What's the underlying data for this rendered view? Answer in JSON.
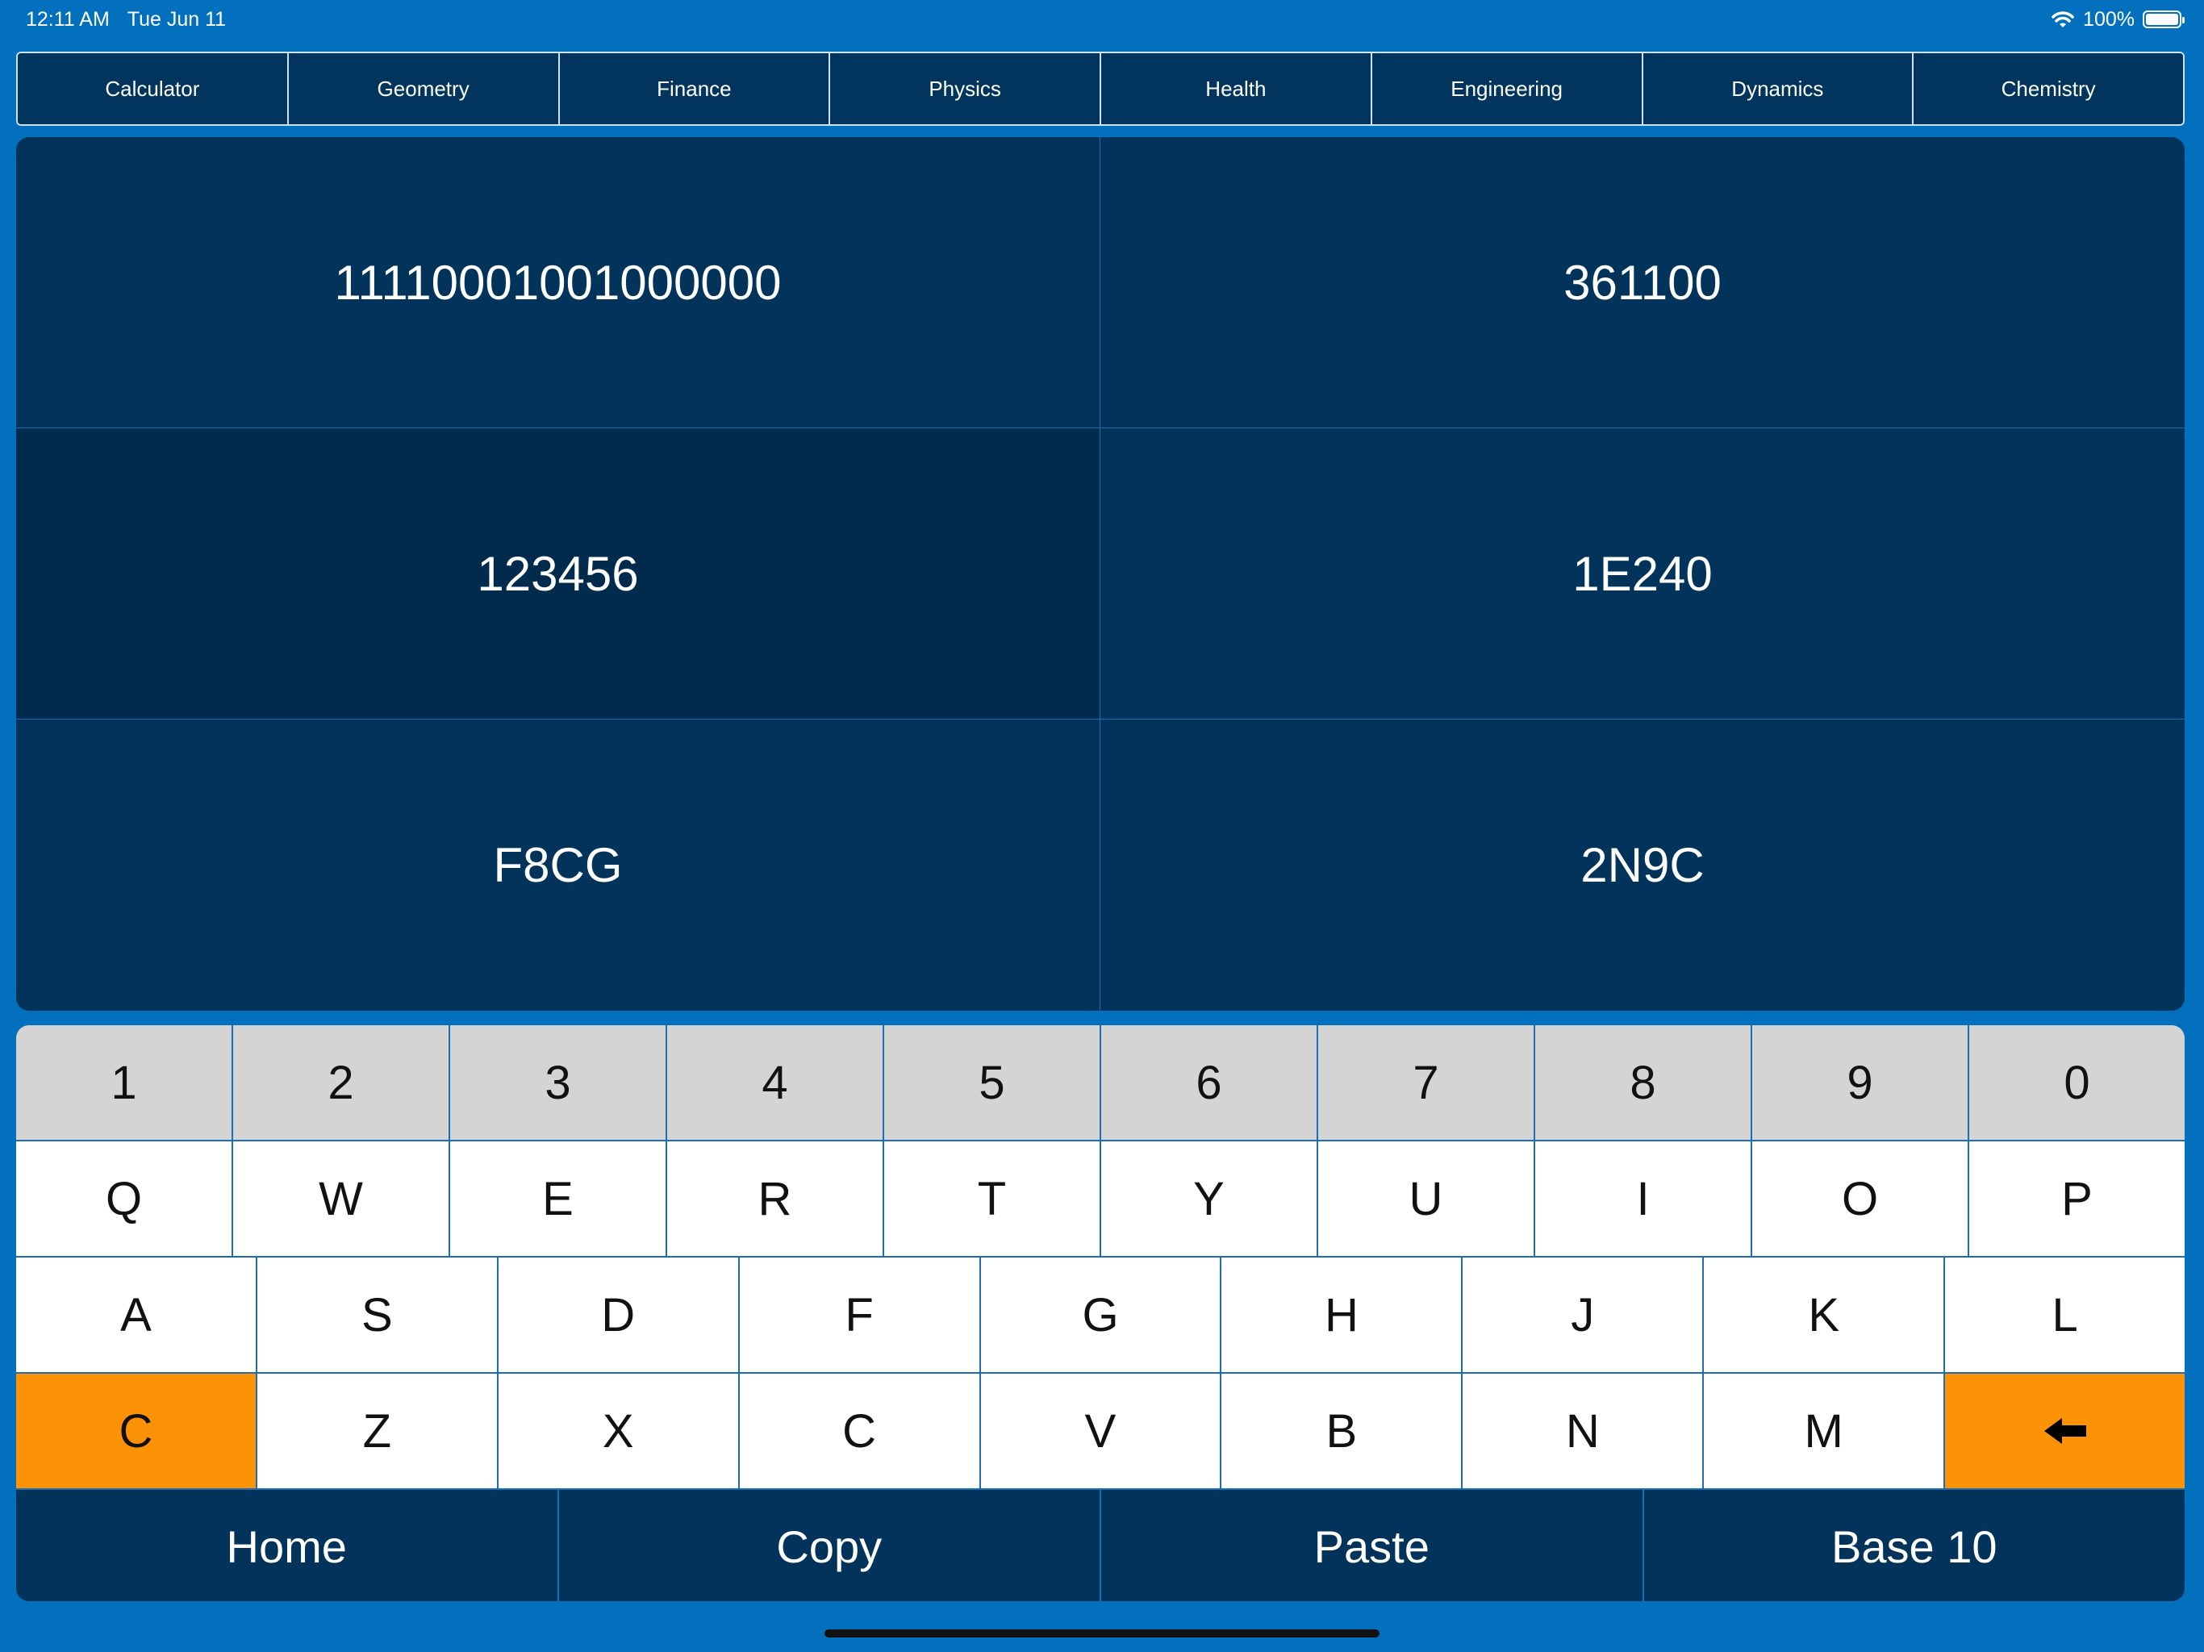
{
  "status": {
    "time": "12:11 AM",
    "date": "Tue Jun 11",
    "battery": "100%",
    "wifi_icon": "wifi-icon",
    "battery_icon": "battery-icon"
  },
  "tabs": [
    "Calculator",
    "Geometry",
    "Finance",
    "Physics",
    "Health",
    "Engineering",
    "Dynamics",
    "Chemistry"
  ],
  "display": {
    "cells": [
      "11110001001000000",
      "361100",
      "123456",
      "1E240",
      "F8CG",
      "2N9C"
    ],
    "selected_index": 2
  },
  "keyboard": {
    "row1": [
      "1",
      "2",
      "3",
      "4",
      "5",
      "6",
      "7",
      "8",
      "9",
      "0"
    ],
    "row2": [
      "Q",
      "W",
      "E",
      "R",
      "T",
      "Y",
      "U",
      "I",
      "O",
      "P"
    ],
    "row3": [
      "A",
      "S",
      "D",
      "F",
      "G",
      "H",
      "J",
      "K",
      "L"
    ],
    "row4": [
      "C",
      "Z",
      "X",
      "C",
      "V",
      "B",
      "N",
      "M"
    ],
    "backspace_icon": "backspace-arrow-icon"
  },
  "actions": {
    "home": "Home",
    "copy": "Copy",
    "paste": "Paste",
    "base": "Base 10"
  },
  "colors": {
    "background": "#0370bd",
    "panel": "#02345b",
    "selected": "#012b4c",
    "accent": "#fc9206",
    "number_keys": "#d4d4d4"
  }
}
